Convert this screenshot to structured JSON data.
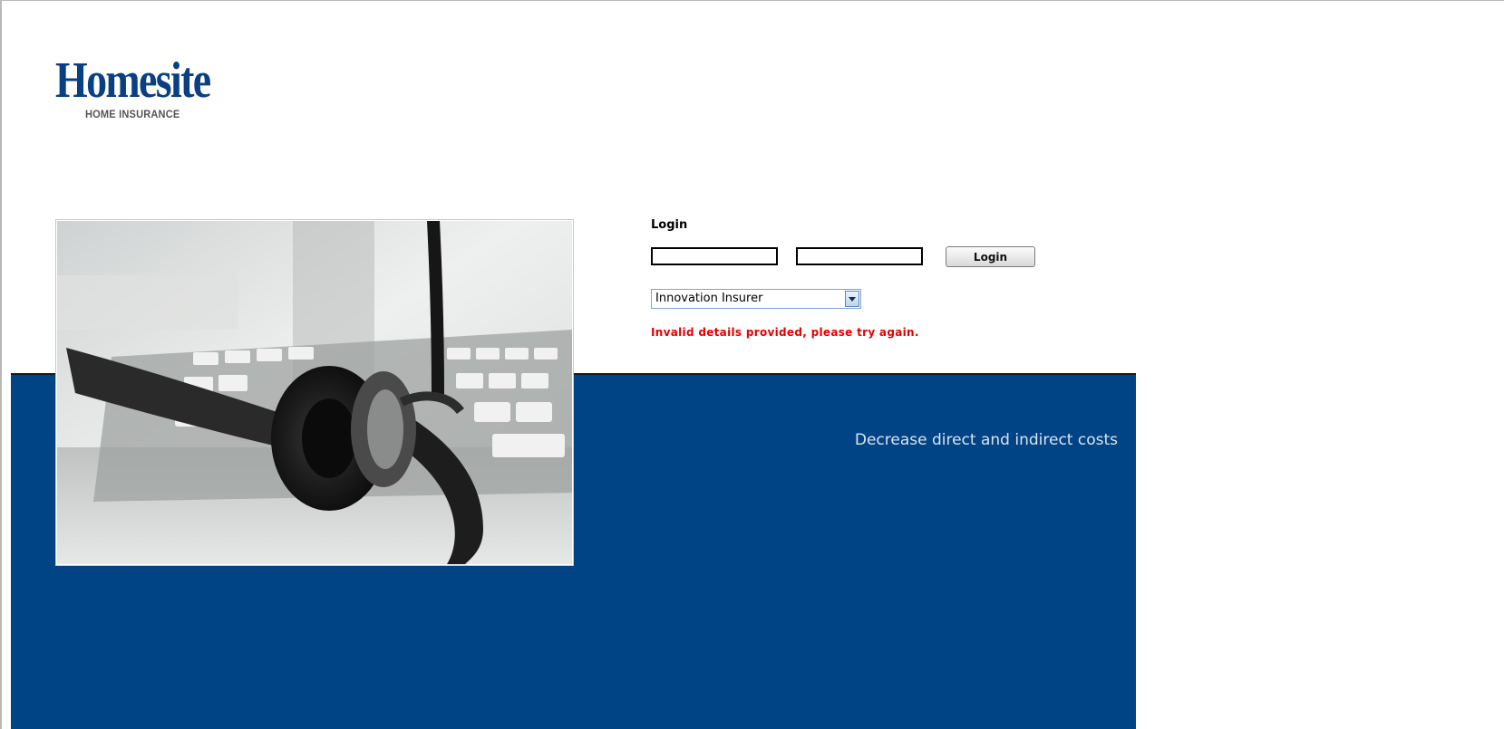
{
  "brand": {
    "logo_name": "Homesite",
    "logo_tagline": "HOME INSURANCE",
    "primary_color": "#0a3f82"
  },
  "photo": {
    "icon": "headset-keyboard-photo"
  },
  "login": {
    "title": "Login",
    "username_value": "",
    "password_value": "",
    "button_label": "Login"
  },
  "insurer_select": {
    "selected": "Innovation Insurer"
  },
  "error": {
    "message": "Invalid details provided, please try again.",
    "color": "#e60000"
  },
  "banner": {
    "tagline": "Decrease direct and indirect costs",
    "background_color": "#014486"
  }
}
